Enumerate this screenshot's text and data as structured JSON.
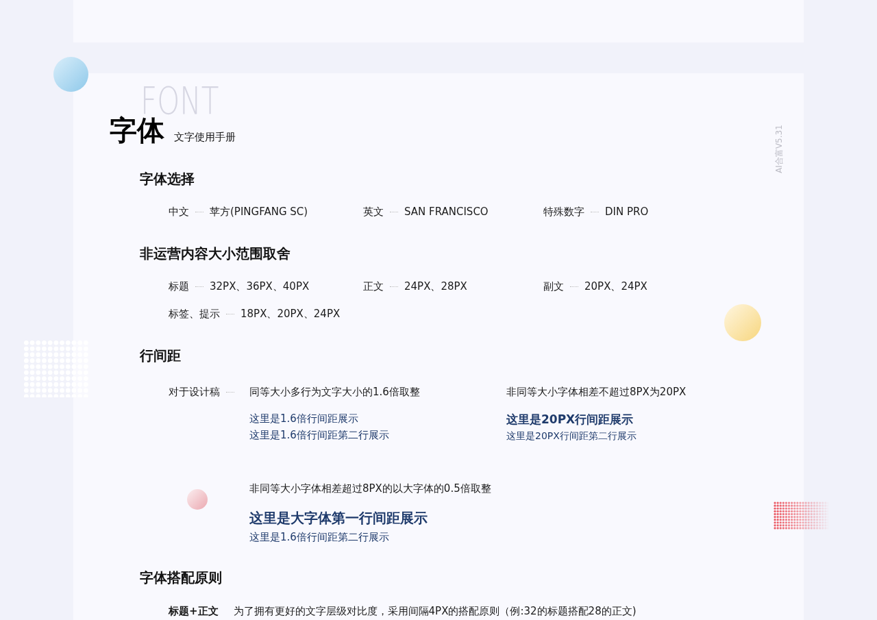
{
  "header": {
    "background_word": "FONT",
    "title": "字体",
    "subtitle": "文字使用手册",
    "version": "AI合富V5.31"
  },
  "sections": [
    {
      "heading": "字体选择",
      "kind": "pairs",
      "rows": [
        [
          {
            "label": "中文",
            "value": "苹方(PINGFANG SC)"
          },
          {
            "label": "英文",
            "value": "SAN FRANCISCO"
          },
          {
            "label": "特殊数字",
            "value": "DIN PRO"
          }
        ]
      ]
    },
    {
      "heading": "非运营内容大小范围取舍",
      "kind": "pairs",
      "rows": [
        [
          {
            "label": "标题",
            "value": "32PX、36PX、40PX"
          },
          {
            "label": "正文",
            "value": "24PX、28PX"
          },
          {
            "label": "副文",
            "value": "20PX、24PX"
          }
        ],
        [
          {
            "label": "标签、提示",
            "value": "18PX、20PX、24PX"
          }
        ]
      ]
    },
    {
      "heading": "行间距",
      "kind": "spacing",
      "label": "对于设计稿",
      "blocks": [
        {
          "rule": "同等大小多行为文字大小的1.6倍取整",
          "lines": [
            {
              "text": "这里是1.6倍行间距展示",
              "kind": "normal"
            },
            {
              "text": "这里是1.6倍行间距第二行展示",
              "kind": "normal"
            }
          ]
        },
        {
          "rule": "非同等大小字体相差不超过8PX为20PX",
          "lines": [
            {
              "text": "这里是20PX行间距展示",
              "kind": "medium"
            },
            {
              "text": "这里是20PX行间距第二行展示",
              "kind": "small"
            }
          ]
        },
        {
          "rule": "非同等大小字体相差超过8PX的以大字体的0.5倍取整",
          "lines": [
            {
              "text": "这里是大字体第一行间距展示",
              "kind": "large"
            },
            {
              "text": "这里是1.6倍行间距第二行展示",
              "kind": "normal"
            }
          ]
        }
      ]
    },
    {
      "heading": "字体搭配原则",
      "kind": "rules",
      "items": [
        {
          "label": "标题+正文",
          "text": "为了拥有更好的文字层级对比度，采用间隔4PX的搭配原则（例:32的标题搭配28的正文)"
        }
      ]
    }
  ]
}
